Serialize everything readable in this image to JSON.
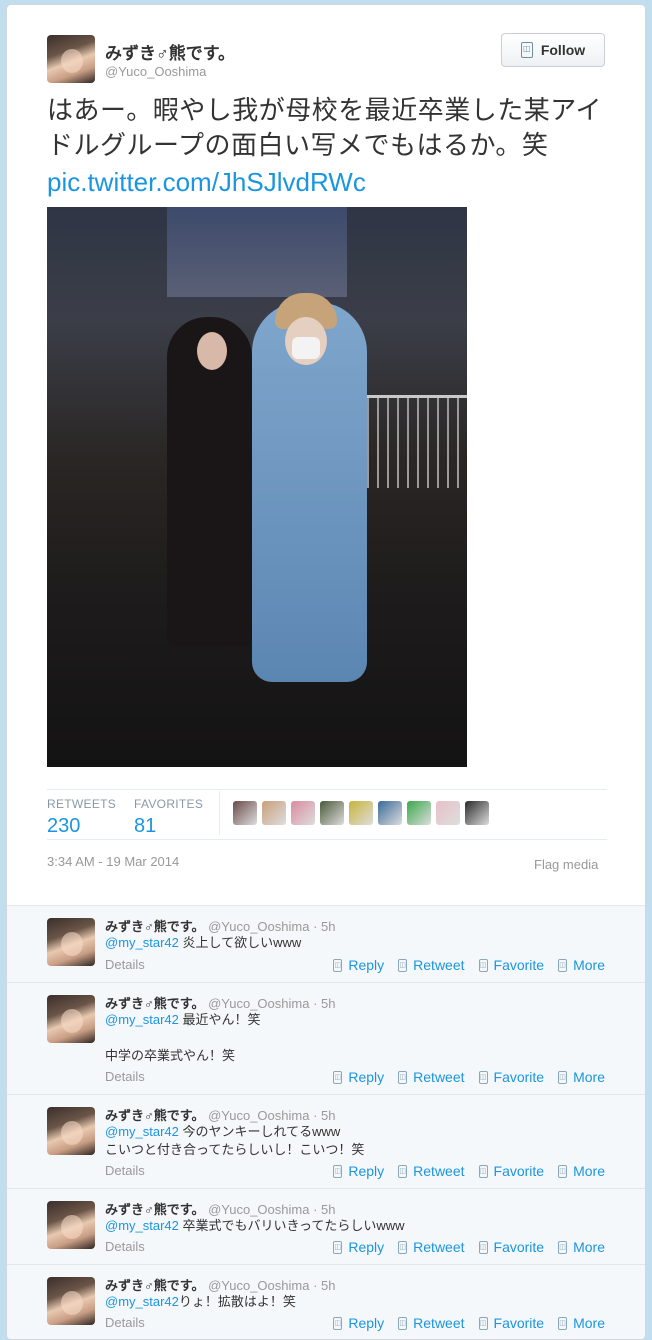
{
  "tweet": {
    "display_name": "みずき♂熊です。",
    "handle": "@Yuco_Ooshima",
    "follow_label": "Follow",
    "text": "はあー。暇やし我が母校を最近卒業した某アイドルグループの面白い写メでもはるか。笑",
    "link": "pic.twitter.com/JhSJlvdRWc",
    "retweets_label": "RETWEETS",
    "retweets_count": "230",
    "favorites_label": "FAVORITES",
    "favorites_count": "81",
    "timestamp": "3:34 AM - 19 Mar 2014",
    "flag_label": "Flag media",
    "favoriter_colors": [
      "#6b4a4a",
      "#c9a07a",
      "#d98ba0",
      "#4a5a3a",
      "#c9b43a",
      "#3a6a9a",
      "#3aa84a",
      "#e8c0c8",
      "#2a2a2a"
    ]
  },
  "actions": {
    "reply": "Reply",
    "retweet": "Retweet",
    "favorite": "Favorite",
    "more": "More",
    "details": "Details"
  },
  "replies": [
    {
      "name": "みずき♂熊です。",
      "handle": "@Yuco_Ooshima",
      "time": "· 5h",
      "mention": "@my_star42",
      "text": " 炎上して欲しいwww"
    },
    {
      "name": "みずき♂熊です。",
      "handle": "@Yuco_Ooshima",
      "time": "· 5h",
      "mention": "@my_star42",
      "text": " 最近やん！笑\n\n中学の卒業式やん！笑"
    },
    {
      "name": "みずき♂熊です。",
      "handle": "@Yuco_Ooshima",
      "time": "· 5h",
      "mention": "@my_star42",
      "text": " 今のヤンキーしれてるwww\nこいつと付き合ってたらしいし！こいつ！笑"
    },
    {
      "name": "みずき♂熊です。",
      "handle": "@Yuco_Ooshima",
      "time": "· 5h",
      "mention": "@my_star42",
      "text": " 卒業式でもバリいきってたらしいwww"
    },
    {
      "name": "みずき♂熊です。",
      "handle": "@Yuco_Ooshima",
      "time": "· 5h",
      "mention": "@my_star42",
      "text": "りょ！拡散はよ！笑"
    }
  ]
}
